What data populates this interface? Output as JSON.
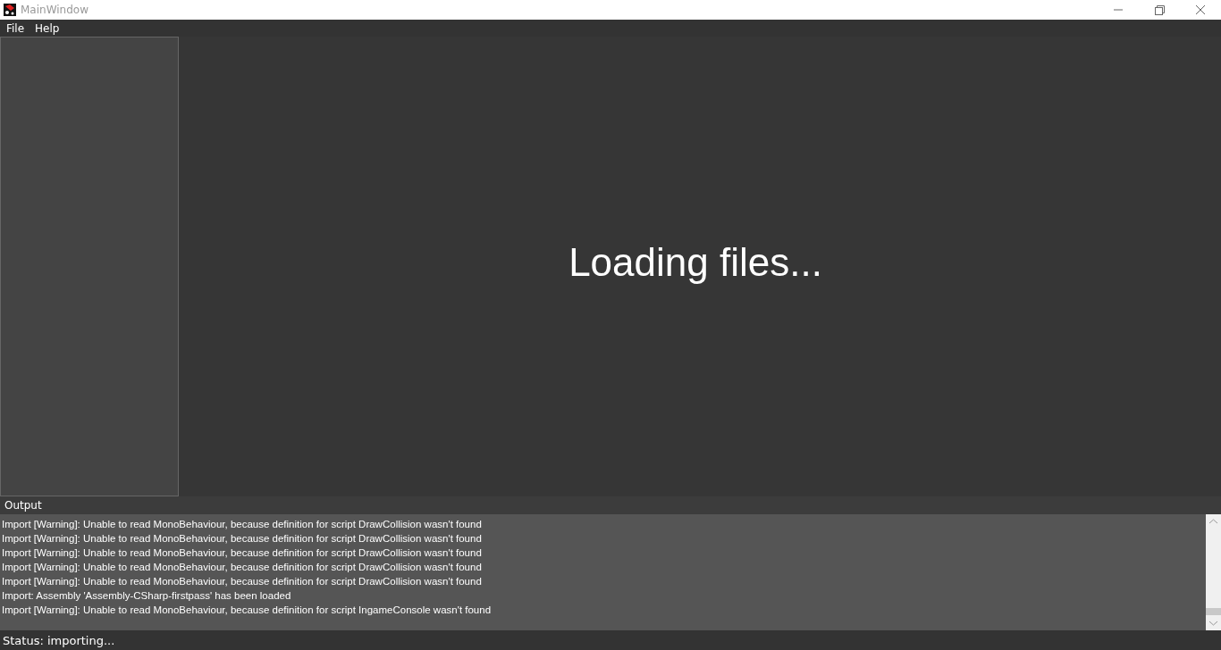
{
  "window": {
    "title": "MainWindow"
  },
  "menu": [
    "File",
    "Help"
  ],
  "main": {
    "message": "Loading files..."
  },
  "output": {
    "title": "Output",
    "lines": [
      "Import [Warning]: Unable to read MonoBehaviour, because definition for script DrawCollision wasn't found",
      "Import [Warning]: Unable to read MonoBehaviour, because definition for script DrawCollision wasn't found",
      "Import [Warning]: Unable to read MonoBehaviour, because definition for script DrawCollision wasn't found",
      "Import [Warning]: Unable to read MonoBehaviour, because definition for script DrawCollision wasn't found",
      "Import [Warning]: Unable to read MonoBehaviour, because definition for script DrawCollision wasn't found",
      "Import: Assembly 'Assembly-CSharp-firstpass' has been loaded",
      "Import [Warning]: Unable to read MonoBehaviour, because definition for script IngameConsole wasn't found"
    ]
  },
  "status_bar": "Status: importing..."
}
